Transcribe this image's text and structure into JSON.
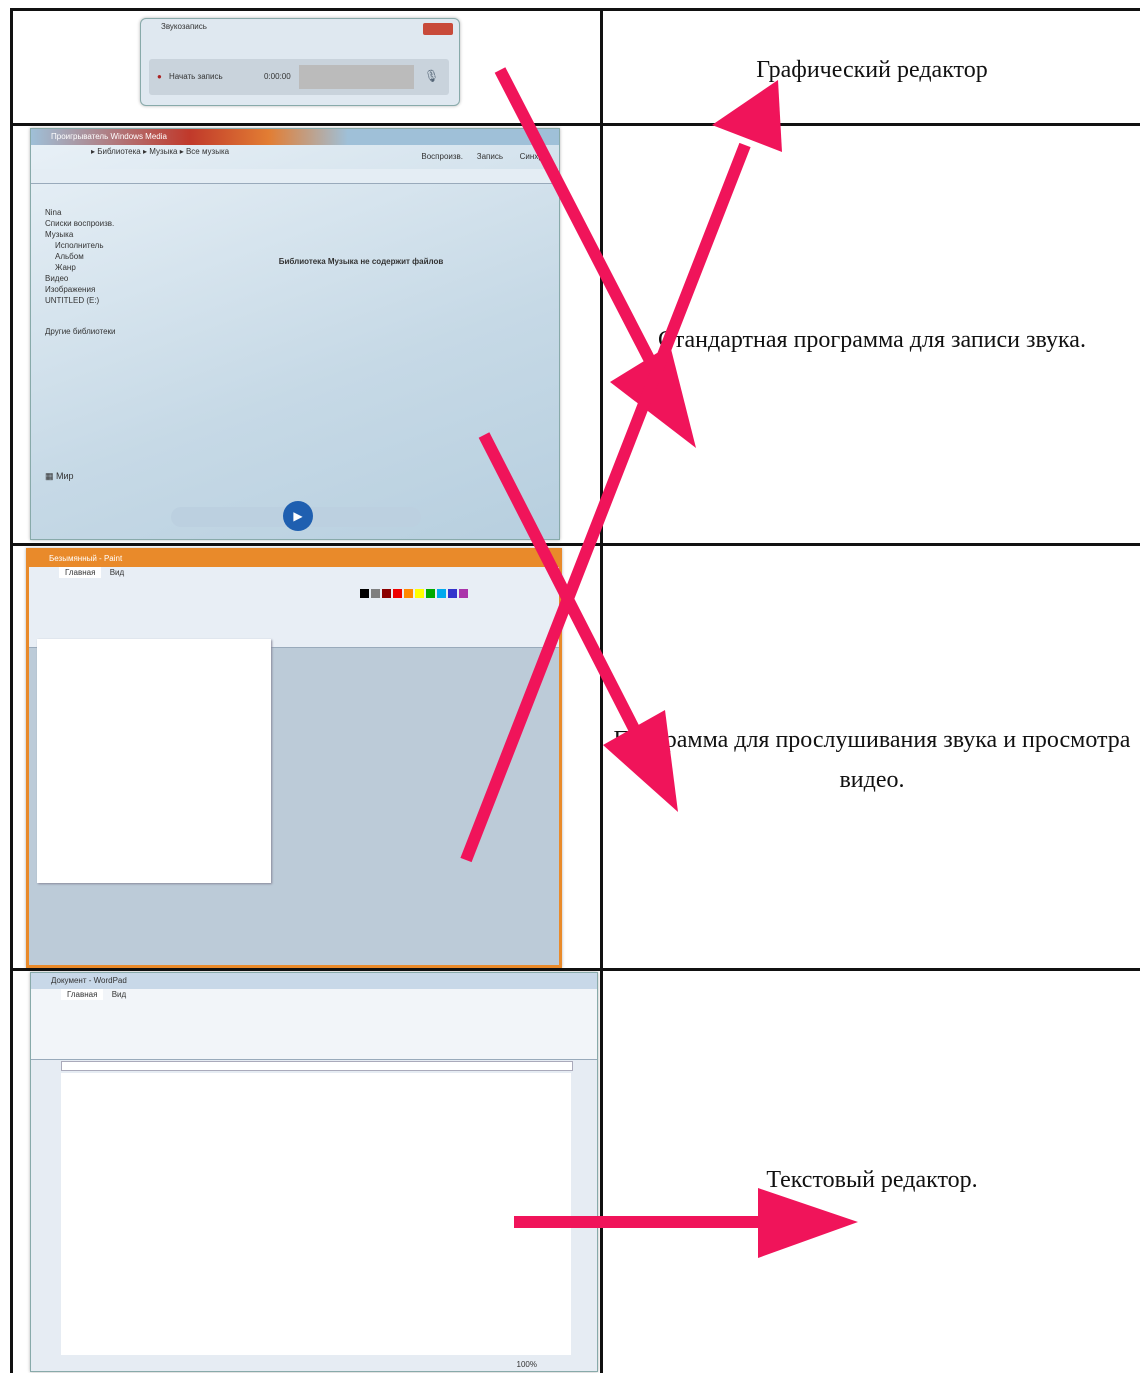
{
  "rows": [
    {
      "label": "Графический редактор",
      "window": {
        "title": "Звукозапись",
        "button": "Начать запись",
        "time": "0:00:00"
      }
    },
    {
      "label": "Стандартная программа для записи звука.",
      "window": {
        "title": "Проигрыватель Windows Media",
        "path": "▸ Библиотека ▸ Музыка ▸ Все музыка",
        "tabs": [
          "Воспроизв.",
          "Запись",
          "Синхр."
        ],
        "sidebar": [
          "Nina",
          "Списки воспроизв.",
          "Музыка",
          "Исполнитель",
          "Альбом",
          "Жанр",
          "Видео",
          "Изображения",
          "UNTITLED (E:)",
          "Другие библиотеки"
        ],
        "library_msg": "Библиотека Музыка не содержит файлов",
        "start": "Мир"
      }
    },
    {
      "label": "Программа для прослушивания звука и просмотра видео.",
      "window": {
        "title": "Безымянный - Paint",
        "tabs": [
          "Главная",
          "Вид"
        ]
      }
    },
    {
      "label": "Текстовый редактор.",
      "window": {
        "title": "Документ - WordPad",
        "tabs": [
          "Главная",
          "Вид"
        ],
        "zoom": "100%"
      }
    }
  ],
  "colors": {
    "arrow": "#f0145a",
    "grid": "#111111",
    "paint_frame": "#e98a2a"
  }
}
